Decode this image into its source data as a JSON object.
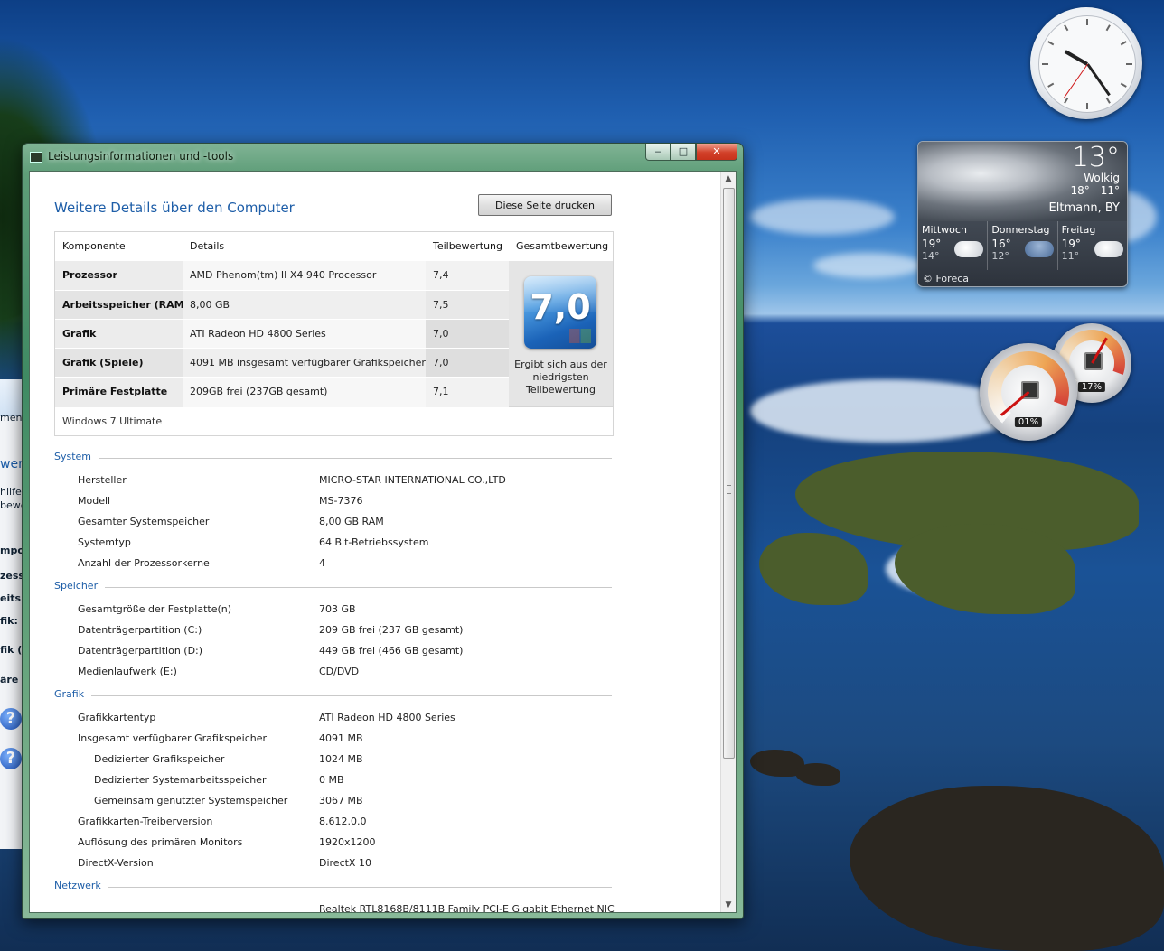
{
  "window": {
    "title": "Leistungsinformationen und -tools",
    "min_glyph": "‒",
    "max_glyph": "□",
    "close_glyph": "✕"
  },
  "page": {
    "title": "Weitere Details über den Computer",
    "print_button": "Diese Seite drucken"
  },
  "score_table": {
    "headers": [
      "Komponente",
      "Details",
      "Teilbewertung",
      "Gesamtbewertung"
    ],
    "rows": [
      {
        "component": "Prozessor",
        "details": "AMD Phenom(tm) II X4 940 Processor",
        "subscore": "7,4"
      },
      {
        "component": "Arbeitsspeicher (RAM)",
        "details": "8,00 GB",
        "subscore": "7,5"
      },
      {
        "component": "Grafik",
        "details": "ATI Radeon HD 4800 Series",
        "subscore": "7,0"
      },
      {
        "component": "Grafik (Spiele)",
        "details": "4091 MB insgesamt verfügbarer Grafikspeicher",
        "subscore": "7,0"
      },
      {
        "component": "Primäre Festplatte",
        "details": "209GB frei (237GB gesamt)",
        "subscore": "7,1"
      }
    ],
    "base_score": "7,0",
    "base_score_note": "Ergibt sich aus der niedrigsten Teilbewertung",
    "os": "Windows 7 Ultimate"
  },
  "sections": {
    "system": {
      "title": "System",
      "items": [
        {
          "label": "Hersteller",
          "value": "MICRO-STAR INTERNATIONAL CO.,LTD"
        },
        {
          "label": "Modell",
          "value": "MS-7376"
        },
        {
          "label": "Gesamter Systemspeicher",
          "value": "8,00 GB RAM"
        },
        {
          "label": "Systemtyp",
          "value": "64 Bit-Betriebssystem"
        },
        {
          "label": "Anzahl der Prozessorkerne",
          "value": "4"
        }
      ]
    },
    "storage": {
      "title": "Speicher",
      "items": [
        {
          "label": "Gesamtgröße der Festplatte(n)",
          "value": "703 GB"
        },
        {
          "label": "Datenträgerpartition (C:)",
          "value": "209 GB frei (237 GB gesamt)"
        },
        {
          "label": "Datenträgerpartition (D:)",
          "value": "449 GB frei (466 GB gesamt)"
        },
        {
          "label": "Medienlaufwerk (E:)",
          "value": "CD/DVD"
        }
      ]
    },
    "graphics": {
      "title": "Grafik",
      "items": [
        {
          "label": "Grafikkartentyp",
          "value": "ATI Radeon HD 4800 Series"
        },
        {
          "label": "Insgesamt verfügbarer Grafikspeicher",
          "value": "4091 MB"
        },
        {
          "label": "Dedizierter Grafikspeicher",
          "value": "1024 MB"
        },
        {
          "label": "Dedizierter Systemarbeitsspeicher",
          "value": "0 MB"
        },
        {
          "label": "Gemeinsam genutzter Systemspeicher",
          "value": "3067 MB"
        },
        {
          "label": "Grafikkarten-Treiberversion",
          "value": "8.612.0.0"
        },
        {
          "label": "Auflösung des primären Monitors",
          "value": "1920x1200"
        },
        {
          "label": "DirectX-Version",
          "value": "DirectX 10"
        }
      ]
    },
    "network": {
      "title": "Netzwerk",
      "items": [
        {
          "label": "",
          "value": "Realtek RTL8168B/8111B Family PCI-E Gigabit Ethernet NIC"
        }
      ]
    }
  },
  "weather_gadget": {
    "temperature": "13°",
    "condition": "Wolkig",
    "range": "18° - 11°",
    "location": "Eltmann, BY",
    "forecast": [
      {
        "day": "Mittwoch",
        "high": "19°",
        "low": "14°",
        "icon": "cloud-icon"
      },
      {
        "day": "Donnerstag",
        "high": "16°",
        "low": "12°",
        "icon": "rain-icon"
      },
      {
        "day": "Freitag",
        "high": "19°",
        "low": "11°",
        "icon": "cloud-icon"
      }
    ],
    "credit": "© Foreca"
  },
  "cpu_gadget": {
    "cpu_percent": "01%",
    "memory_percent": "17%"
  },
  "clock_gadget": {
    "hour_hand_deg": 300,
    "minute_hand_deg": 145,
    "second_hand_deg": 215
  },
  "background_window_fragments": {
    "texts": [
      "men",
      "wert",
      "hilfe",
      "bewe",
      "mpo",
      "zess",
      "eits",
      "fik:",
      "fik (S",
      "äre"
    ],
    "help_glyph": "?"
  },
  "colors": {
    "link_blue": "#1e5ea8",
    "window_frame": "#4f9470",
    "close_red": "#c8321b"
  }
}
